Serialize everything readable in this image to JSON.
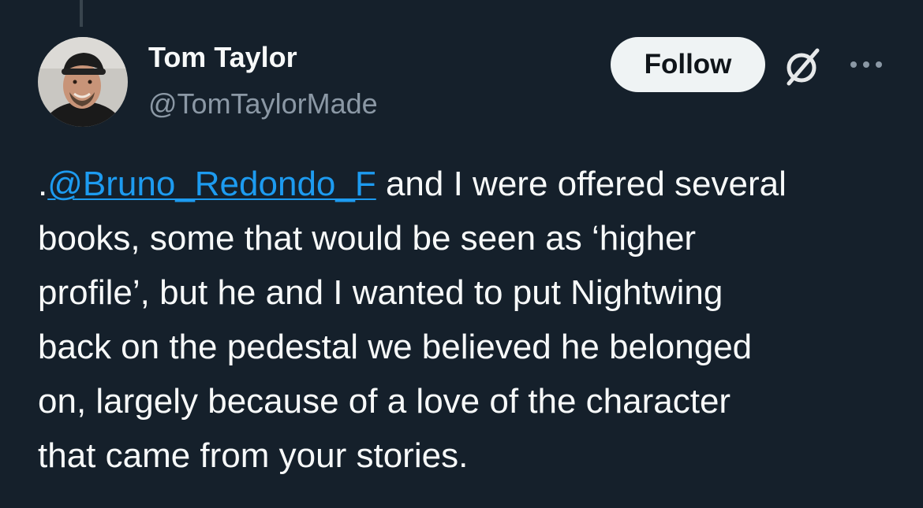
{
  "tweet": {
    "author": {
      "name": "Tom Taylor",
      "handle": "@TomTaylorMade",
      "avatar_icon": "user-avatar-photo"
    },
    "actions": {
      "follow_label": "Follow",
      "grok_icon": "grok-icon",
      "more_icon": "more-options-icon"
    },
    "text": {
      "prefix": ".",
      "mention": "@Bruno_Redondo_F",
      "line1_rest": " and I were offered several",
      "line2": "books, some that would be seen as ‘higher",
      "line3": "profile’, but he and I wanted to put Nightwing",
      "line4": "back on the pedestal we believed he belonged",
      "line5": "on, largely because of a love of the character",
      "line6": "that came from your stories."
    }
  },
  "colors": {
    "background": "#15202b",
    "text_primary": "#f7f9f9",
    "text_secondary": "#8b98a5",
    "link": "#1d9bf0",
    "follow_bg": "#eff3f4",
    "follow_text": "#0f1419",
    "thread_line": "#38444d"
  }
}
